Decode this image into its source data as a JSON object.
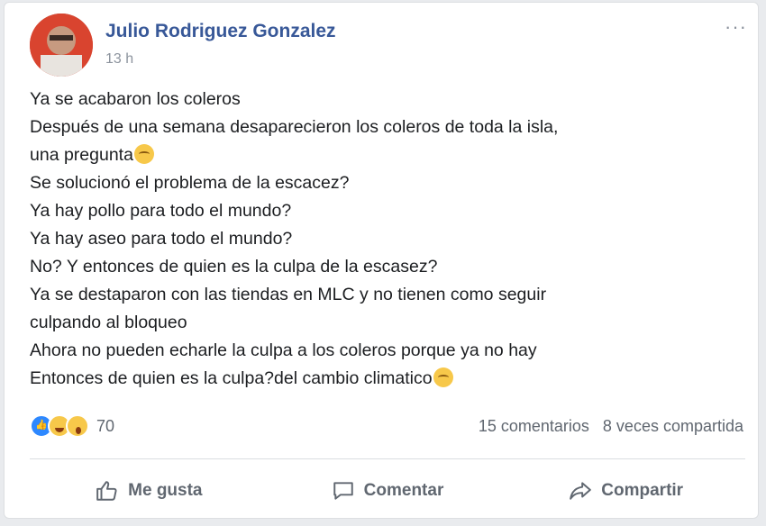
{
  "post": {
    "author": "Julio Rodriguez Gonzalez",
    "time": "13 h",
    "more_label": "···",
    "lines": [
      "Ya se acabaron los coleros",
      "Después de una semana desaparecieron los coleros de toda la isla,",
      "una pregunta",
      "Se solucionó el problema de la escacez?",
      "Ya hay pollo para todo el mundo?",
      "Ya hay aseo para todo el mundo?",
      "No? Y entonces de quien es la culpa de la escasez?",
      "Ya se destaparon con las tiendas en MLC y no tienen como seguir",
      "culpando al bloqueo",
      "Ahora no pueden echarle la culpa a los coleros porque ya no hay",
      "Entonces de quien es la culpa?del cambio climatico"
    ]
  },
  "reactions": {
    "icons": [
      "like-icon",
      "haha-icon",
      "wow-icon"
    ],
    "count": "70"
  },
  "stats": {
    "comments": "15 comentarios",
    "shares": "8 veces compartida"
  },
  "actions": {
    "like": "Me gusta",
    "comment": "Comentar",
    "share": "Compartir"
  },
  "colors": {
    "author": "#385898",
    "text": "#1c1e21",
    "muted": "#606770",
    "like": "#2d88ff",
    "emoji": "#f7c84a"
  }
}
